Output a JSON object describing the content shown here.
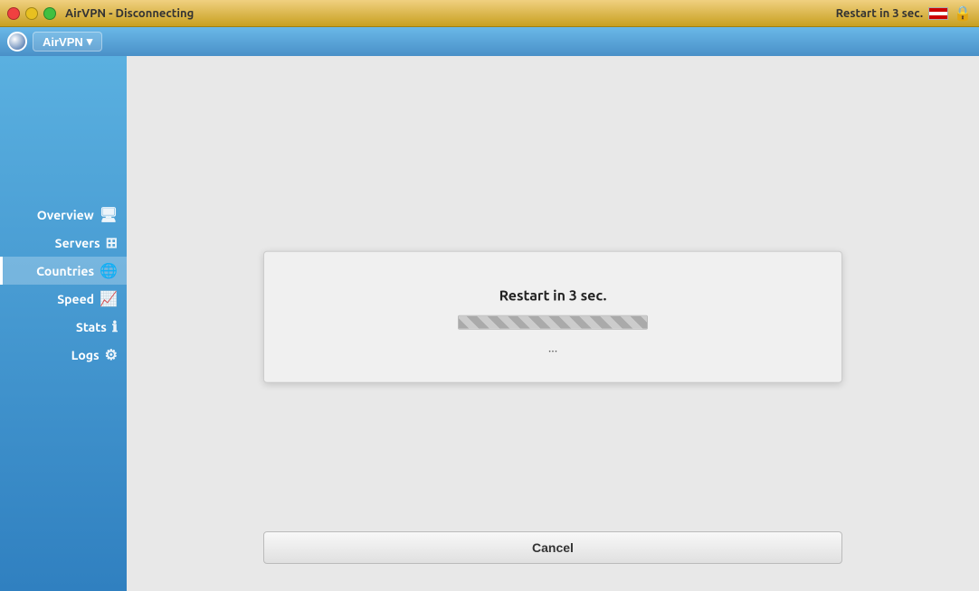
{
  "titlebar": {
    "title": "AirVPN - Disconnecting",
    "status_text": "Restart in 3 sec.",
    "close_label": "×",
    "min_label": "−",
    "max_label": "□"
  },
  "menubar": {
    "logo_alt": "AirVPN logo",
    "menu_label": "AirVPN",
    "dropdown_arrow": "▾"
  },
  "sidebar": {
    "items": [
      {
        "label": "Overview",
        "icon": "🖥",
        "id": "overview",
        "active": false
      },
      {
        "label": "Servers",
        "icon": "⊞",
        "id": "servers",
        "active": false
      },
      {
        "label": "Countries",
        "icon": "🌐",
        "id": "countries",
        "active": true
      },
      {
        "label": "Speed",
        "icon": "📈",
        "id": "speed",
        "active": false
      },
      {
        "label": "Stats",
        "icon": "ℹ",
        "id": "stats",
        "active": false
      },
      {
        "label": "Logs",
        "icon": "⚙",
        "id": "logs",
        "active": false
      }
    ]
  },
  "dialog": {
    "restart_text": "Restart in 3 sec.",
    "dots": "...",
    "cancel_label": "Cancel"
  }
}
